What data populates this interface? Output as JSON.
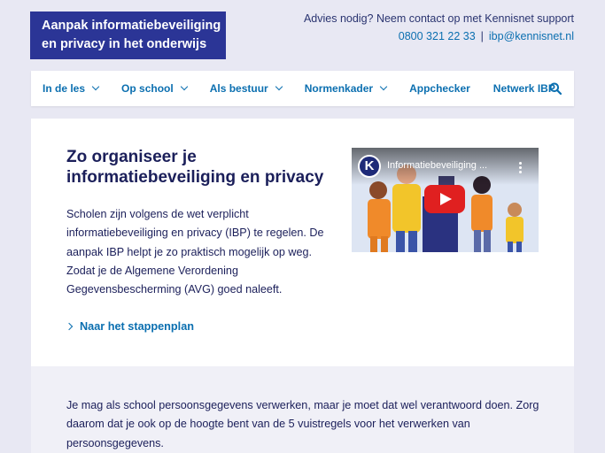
{
  "site": {
    "logo_line1": "Aanpak informatiebeveiliging",
    "logo_line2": "en privacy in het onderwijs"
  },
  "contact": {
    "prompt": "Advies nodig? Neem contact op met Kennisnet support",
    "phone": "0800 321 22 33",
    "separator": "|",
    "email": "ibp@kennisnet.nl"
  },
  "nav": {
    "items": [
      {
        "label": "In de les",
        "dropdown": true
      },
      {
        "label": "Op school",
        "dropdown": true
      },
      {
        "label": "Als bestuur",
        "dropdown": true
      },
      {
        "label": "Normenkader",
        "dropdown": true
      },
      {
        "label": "Appchecker",
        "dropdown": false
      },
      {
        "label": "Netwerk IBP",
        "dropdown": false
      }
    ],
    "search_icon": "search-icon"
  },
  "hero": {
    "title": "Zo organiseer je informatiebeveiliging en privacy",
    "intro": "Scholen zijn volgens de wet verplicht informatiebeveiliging en privacy (IBP) te regelen. De aanpak IBP helpt je zo praktisch mogelijk op weg. Zodat je de Algemene Verordening Gegevensbescherming (AVG) goed naleeft.",
    "link_label": "Naar het stappenplan",
    "video": {
      "channel_logo_letter": "K",
      "title": "Informatiebeveiliging ...",
      "play_icon": "youtube-play-icon"
    }
  },
  "section2": {
    "text": "Je mag als school persoonsgegevens verwerken, maar je moet dat wel verantwoord doen. Zorg daarom dat je ook op de hoogte bent van de 5 vuistregels voor het verwerken van persoonsgegevens."
  },
  "colors": {
    "brand": "#2b3596",
    "link": "#0b6fb0",
    "text": "#1b1f5a",
    "background": "#e8e8f3",
    "play": "#e02020"
  }
}
